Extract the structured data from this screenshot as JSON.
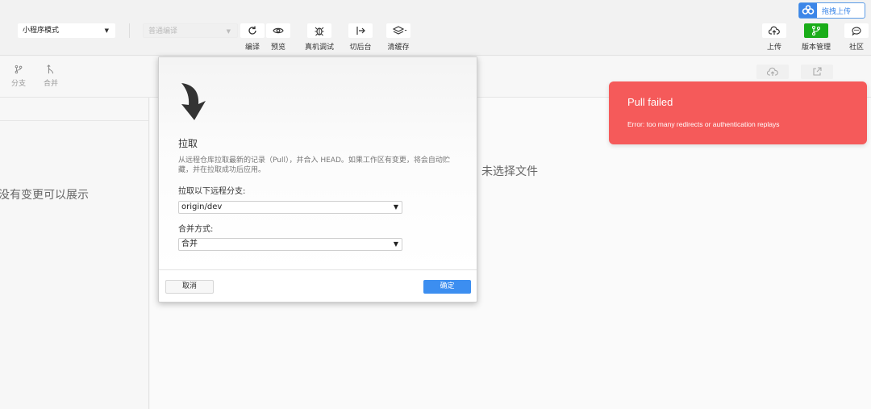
{
  "toolbar": {
    "mode_select": "小程序模式",
    "compile_select": "普通编译",
    "tools": [
      {
        "label": "编译",
        "icon": "refresh-icon"
      },
      {
        "label": "预览",
        "icon": "eye-icon"
      },
      {
        "label": "真机调试",
        "icon": "bug-icon"
      },
      {
        "label": "切后台",
        "icon": "switch-background-icon"
      },
      {
        "label": "清缓存",
        "icon": "layers-icon"
      }
    ],
    "right_tools": [
      {
        "label": "上传",
        "icon": "cloud-upload-icon"
      },
      {
        "label": "版本管理",
        "icon": "branch-icon",
        "accent": "#1aad19"
      },
      {
        "label": "社区",
        "icon": "chat-icon"
      }
    ],
    "drag_upload": "拖拽上传"
  },
  "subbar": {
    "branch_label": "分支",
    "merge_label": "合并"
  },
  "left_panel": {
    "empty_text": "没有变更可以展示"
  },
  "main": {
    "empty_text": "未选择文件"
  },
  "dialog": {
    "title": "拉取",
    "description": "从远程仓库拉取最新的记录（Pull），并合入 HEAD。如果工作区有变更，将会自动贮藏，并在拉取成功后应用。",
    "branch_label": "拉取以下远程分支:",
    "branch_value": "origin/dev",
    "merge_label": "合并方式:",
    "merge_value": "合并",
    "cancel": "取消",
    "ok": "确定"
  },
  "toast": {
    "title": "Pull failed",
    "message": "Error: too many redirects or authentication replays",
    "color": "#f55a5a"
  }
}
